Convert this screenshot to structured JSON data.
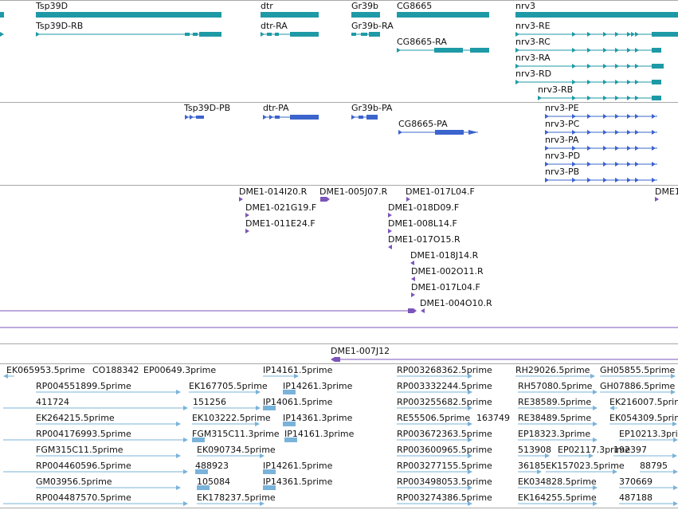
{
  "colors": {
    "gene": "#1e9aa6",
    "protein": "#3b64cc",
    "primer": "#7b55b8",
    "est": "#7ab3d9",
    "separator": "#a8a8a8"
  },
  "tracks": {
    "genes": [
      {
        "label": "Tsp39D"
      },
      {
        "label": "dtr"
      },
      {
        "label": "Gr39b"
      },
      {
        "label": "CG8665"
      },
      {
        "label": "nrv3"
      }
    ],
    "transcripts": [
      {
        "label": "Tsp39D-RB"
      },
      {
        "label": "dtr-RA"
      },
      {
        "label": "Gr39b-RA"
      },
      {
        "label": "CG8665-RA"
      },
      {
        "label": "nrv3-RE"
      },
      {
        "label": "nrv3-RC"
      },
      {
        "label": "nrv3-RA"
      },
      {
        "label": "nrv3-RD"
      },
      {
        "label": "nrv3-RB"
      }
    ],
    "proteins": [
      {
        "label": "Tsp39D-PB"
      },
      {
        "label": "dtr-PA"
      },
      {
        "label": "Gr39b-PA"
      },
      {
        "label": "CG8665-PA"
      },
      {
        "label": "nrv3-PE"
      },
      {
        "label": "nrv3-PC"
      },
      {
        "label": "nrv3-PA"
      },
      {
        "label": "nrv3-PD"
      },
      {
        "label": "nrv3-PB"
      }
    ],
    "primers": [
      {
        "label": "DME1-014I20.R"
      },
      {
        "label": "DME1-005J07.R"
      },
      {
        "label": "DME1-017L04.F"
      },
      {
        "label": "DME1"
      },
      {
        "label": "DME1-021G19.F"
      },
      {
        "label": "DME1-018D09.F"
      },
      {
        "label": "DME1-011E24.F"
      },
      {
        "label": "DME1-008L14.F"
      },
      {
        "label": "DME1-017O15.R"
      },
      {
        "label": "DME1-018J14.R"
      },
      {
        "label": "DME1-002O11.R"
      },
      {
        "label": "DME1-017L04.F"
      },
      {
        "label": "DME1-004O10.R"
      }
    ],
    "clone": {
      "label": "DME1-007J12"
    },
    "ests": [
      {
        "label": "EK065953.5prime"
      },
      {
        "label": "CO188342"
      },
      {
        "label": "EP00649.3prime"
      },
      {
        "label": "IP14161.5prime"
      },
      {
        "label": "RP003268362.5prime"
      },
      {
        "label": "RH29026.5prime"
      },
      {
        "label": "GH05855.5prime"
      },
      {
        "label": "RP004551899.5prime"
      },
      {
        "label": "EK167705.5prime"
      },
      {
        "label": "IP14261.3prime"
      },
      {
        "label": "RP003332244.5prime"
      },
      {
        "label": "RH57080.5prime"
      },
      {
        "label": "GH07886.5prime"
      },
      {
        "label": "411724"
      },
      {
        "label": "151256"
      },
      {
        "label": "IP14061.5prime"
      },
      {
        "label": "RP003255682.5prime"
      },
      {
        "label": "RE38589.5prime"
      },
      {
        "label": "EK216007.5prime"
      },
      {
        "label": "EK264215.5prime"
      },
      {
        "label": "EK103222.5prime"
      },
      {
        "label": "IP14361.3prime"
      },
      {
        "label": "RE55506.5prime"
      },
      {
        "label": "163749"
      },
      {
        "label": "RE38489.5prime"
      },
      {
        "label": "EK054309.5prime"
      },
      {
        "label": "RP004176993.5prime"
      },
      {
        "label": "FGM315C11.3prime"
      },
      {
        "label": "IP14161.3prime"
      },
      {
        "label": "RP003672363.5prime"
      },
      {
        "label": "EP18323.3prime"
      },
      {
        "label": "EP10213.3prime"
      },
      {
        "label": "FGM315C11.5prime"
      },
      {
        "label": "EK090734.5prime"
      },
      {
        "label": "RP003600965.5prime"
      },
      {
        "label": "513908"
      },
      {
        "label": "EP02117.3prime"
      },
      {
        "label": "192397"
      },
      {
        "label": "RP004460596.5prime"
      },
      {
        "label": "488923"
      },
      {
        "label": "IP14261.5prime"
      },
      {
        "label": "RP003277155.5prime"
      },
      {
        "label": "36185"
      },
      {
        "label": "EK157023.5prime"
      },
      {
        "label": "88795"
      },
      {
        "label": "GM03956.5prime"
      },
      {
        "label": "105084"
      },
      {
        "label": "IP14361.5prime"
      },
      {
        "label": "RP003498053.5prime"
      },
      {
        "label": "EK034828.5prime"
      },
      {
        "label": "370669"
      },
      {
        "label": "RP004487570.5prime"
      },
      {
        "label": "EK178237.5prime"
      },
      {
        "label": "RP003274386.5prime"
      },
      {
        "label": "EK164255.5prime"
      },
      {
        "label": "487188"
      }
    ]
  }
}
